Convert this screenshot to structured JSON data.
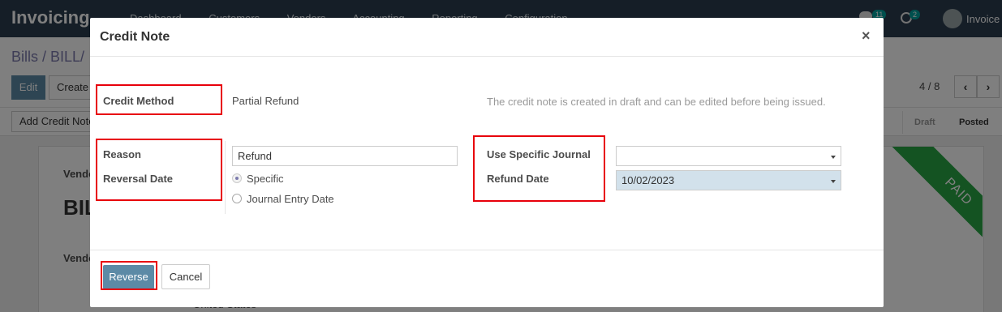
{
  "app": {
    "name": "Invoicing",
    "menu": [
      "Dashboard",
      "Customers",
      "Vendors",
      "Accounting",
      "Reporting",
      "Configuration"
    ],
    "chat_badge": "11",
    "activity_badge": "2",
    "user": "Invoice"
  },
  "control": {
    "breadcrumb": "Bills / BILL/",
    "edit_label": "Edit",
    "create_label": "Create",
    "pager": "4 / 8",
    "add_credit_note_label": "Add Credit Note",
    "stages": [
      "Draft",
      "Posted"
    ]
  },
  "sheet": {
    "vendor_label": "Vendor",
    "bill_prefix": "BIL",
    "vendor_label_2": "Vendor",
    "country": "United States",
    "ribbon": "PAID"
  },
  "modal": {
    "title": "Credit Note",
    "close": "×",
    "credit_method_label": "Credit Method",
    "credit_method_value": "Partial Refund",
    "info_text": "The credit note is created in draft and can be edited before being issued.",
    "reason_label": "Reason",
    "reversal_date_label": "Reversal Date",
    "reason_value": "Refund",
    "reversal_options": [
      "Specific",
      "Journal Entry Date"
    ],
    "reversal_selected": "Specific",
    "journal_label": "Use Specific Journal",
    "journal_value": "",
    "refund_date_label": "Refund Date",
    "refund_date_value": "10/02/2023",
    "reverse_label": "Reverse",
    "cancel_label": "Cancel"
  },
  "colors": {
    "navbar": "#2b3d4f",
    "primary_button": "#5c8aa6",
    "highlight": "#e8000b",
    "paid_ribbon": "#28a745",
    "date_field": "#d2e1eb"
  }
}
